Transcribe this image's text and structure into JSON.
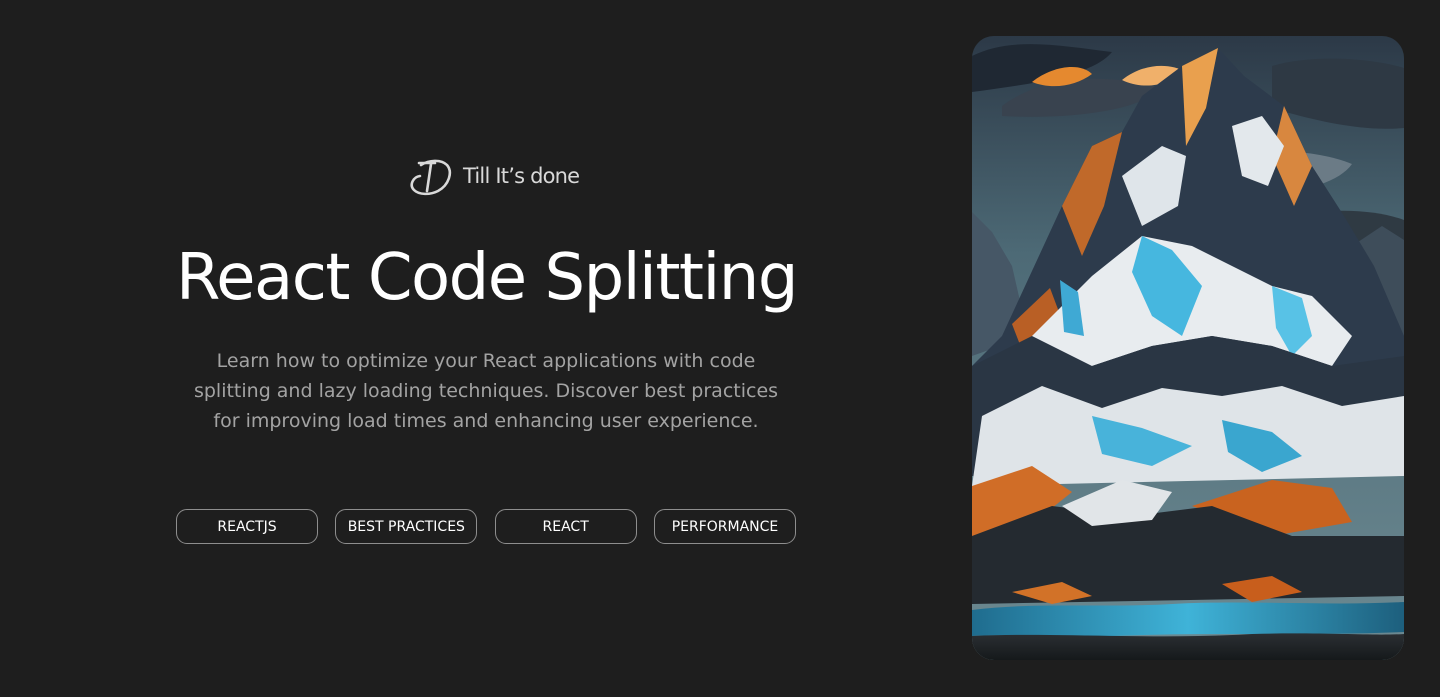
{
  "brand": {
    "name": "Till It’s done",
    "logo_icon": "td-monogram-logo"
  },
  "title": "React Code Splitting",
  "description": "Learn how to optimize your React applications with code splitting and lazy loading techniques. Discover best practices for improving load times and enhancing user experience.",
  "tags": [
    "REACTJS",
    "BEST PRACTICES",
    "REACT",
    "PERFORMANCE"
  ],
  "hero_image": {
    "subject": "mountain-landscape-illustration"
  },
  "colors": {
    "background": "#1e1e1e",
    "title": "#ffffff",
    "description": "#a3a3a3",
    "tag_border": "#8e8e8e"
  }
}
